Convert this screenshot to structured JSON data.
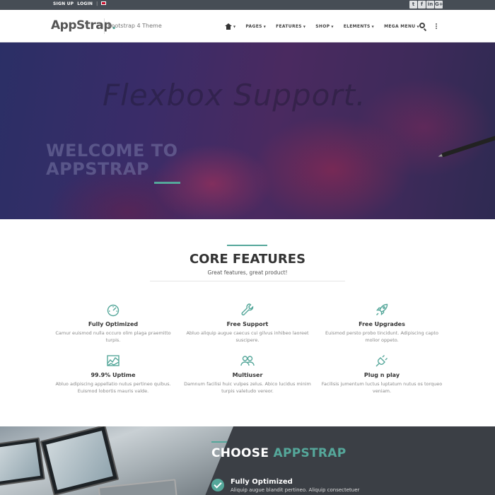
{
  "topbar": {
    "signup_label": "SIGN UP",
    "login_label": "LOGIN",
    "separator": "|",
    "social_icons": [
      "twitter-icon",
      "facebook-icon",
      "linkedin-icon",
      "google-plus-icon"
    ],
    "social_glyphs": [
      "t",
      "f",
      "in",
      "G+"
    ]
  },
  "header": {
    "logo_main": "AppStrap",
    "logo_dot": ".",
    "tagline": "Bootstrap 4 Theme",
    "nav": [
      "PAGES",
      "FEATURES",
      "SHOP",
      "ELEMENTS",
      "MEGA MENU"
    ]
  },
  "hero": {
    "banner": "Flexbox Support.",
    "welcome_line1": "WELCOME TO",
    "welcome_line2": "APPSTRAP"
  },
  "core": {
    "title": "CORE FEATURES",
    "subtitle": "Great features, great product!",
    "features": [
      {
        "title": "Fully Optimized",
        "desc": "Camur euismod nulla occuro olim plaga praemitto turpis.",
        "icon": "speedometer-icon"
      },
      {
        "title": "Free Support",
        "desc": "Abluo aliquip augue caecus cui gilvus inhibeo laoreet suscipere.",
        "icon": "wrench-icon"
      },
      {
        "title": "Free Upgrades",
        "desc": "Euismod persto probo tincidunt. Adipiscing capto molior oppeto.",
        "icon": "rocket-icon"
      },
      {
        "title": "99.9% Uptime",
        "desc": "Abluo adipiscing appellatio nutus pertineo quibus. Euismod lobortis mauris valde.",
        "icon": "chart-icon"
      },
      {
        "title": "Multiuser",
        "desc": "Damnum facilisi huic vulpes zelus. Abico lucidus minim turpis valetudo vereor.",
        "icon": "users-icon"
      },
      {
        "title": "Plug n play",
        "desc": "Facilisis jumentum luctus luptatum nutus os torqueo veniam.",
        "icon": "plug-icon"
      }
    ]
  },
  "choose": {
    "title_prefix": "CHOOSE",
    "title_accent": "APPSTRAP",
    "item_title": "Fully Optimized",
    "item_desc": "Aliquip augue blandit pertineo. Aliquip consectetuer"
  },
  "colors": {
    "accent": "#55a79a",
    "topbar": "#464d55",
    "dark_section": "#3b3f45"
  }
}
